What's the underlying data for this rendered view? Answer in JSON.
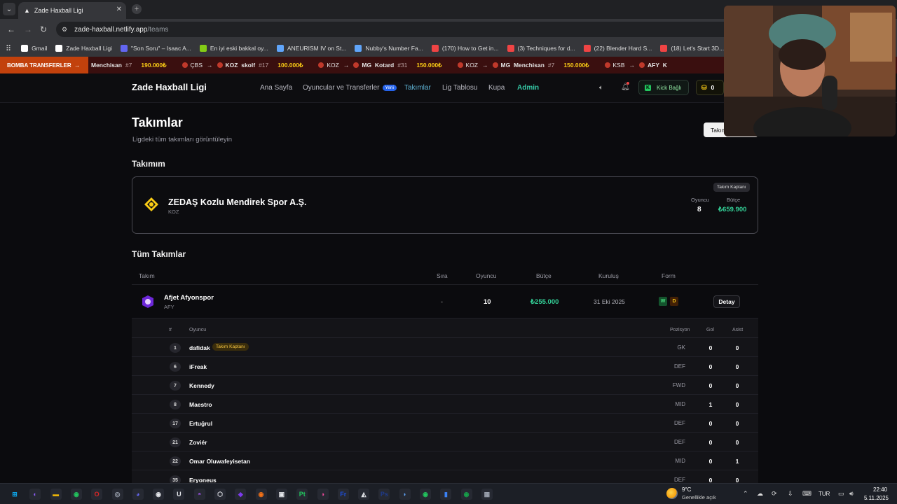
{
  "browser": {
    "tab_title": "Zade Haxball Ligi",
    "url_host": "zade-haxball.netlify.app",
    "url_path": "/teams",
    "bookmarks": [
      {
        "label": "Gmail",
        "color": "#ffffff"
      },
      {
        "label": "Zade Haxball Ligi",
        "color": "#ffffff"
      },
      {
        "label": "\"Son Soru\" – Isaac A...",
        "color": "#6366f1"
      },
      {
        "label": "En iyi eski bakkal oy...",
        "color": "#84cc16"
      },
      {
        "label": "ANEURISM IV on St...",
        "color": "#60a5fa"
      },
      {
        "label": "Nubby's Number Fa...",
        "color": "#60a5fa"
      },
      {
        "label": "(170) How to Get in...",
        "color": "#ef4444"
      },
      {
        "label": "(3) Techniques for d...",
        "color": "#ef4444"
      },
      {
        "label": "(22) Blender Hard S...",
        "color": "#ef4444"
      },
      {
        "label": "(18) Let's Start 3D...",
        "color": "#ef4444"
      },
      {
        "label": "(214) Av...",
        "color": "#ef4444"
      }
    ]
  },
  "ticker": {
    "label": "BOMBA TRANSFERLER",
    "items": [
      {
        "name": "Menchisan",
        "no": "#7",
        "price": "190.000₺",
        "from": "",
        "to": ""
      },
      {
        "from": "ÇBS",
        "to": "KOZ",
        "name": "skolf",
        "no": "#17",
        "price": "100.000₺"
      },
      {
        "from": "KOZ",
        "to": "MG",
        "name": "Kotard",
        "no": "#31",
        "price": "150.000₺"
      },
      {
        "from": "KOZ",
        "to": "MG",
        "name": "Menchisan",
        "no": "#7",
        "price": "150.000₺"
      },
      {
        "from": "KSB",
        "to": "AFY",
        "name": "K",
        "no": "",
        "price": ""
      }
    ]
  },
  "nav": {
    "brand": "Zade Haxball Ligi",
    "links": {
      "home": "Ana Sayfa",
      "players": "Oyuncular ve Transferler",
      "new_badge": "Yeni",
      "teams": "Takımlar",
      "table": "Lig Tablosu",
      "cup": "Kupa",
      "admin": "Admin"
    },
    "kick_label": "Kick Bağlı",
    "coins": "0"
  },
  "page": {
    "title": "Takımlar",
    "subtitle": "Ligdeki tüm takımları görüntüleyin",
    "create_button": "Takım K..."
  },
  "my_team": {
    "heading": "Takımım",
    "name": "ZEDAŞ Kozlu Mendirek Spor A.Ş.",
    "code": "KOZ",
    "captain_badge": "Takım Kaptanı",
    "players_label": "Oyuncu",
    "players": "8",
    "budget_label": "Bütçe",
    "budget": "₺659.900"
  },
  "all_teams": {
    "heading": "Tüm Takımlar",
    "columns": {
      "team": "Takım",
      "rank": "Sıra",
      "players": "Oyuncu",
      "budget": "Bütçe",
      "founded": "Kuruluş",
      "form": "Form"
    },
    "rows": [
      {
        "name": "Afjet Afyonspor",
        "code": "AFY",
        "rank": "-",
        "players": "10",
        "budget": "₺255.000",
        "founded": "31 Eki 2025",
        "form": [
          "W",
          "D"
        ],
        "detail_label": "Detay"
      }
    ]
  },
  "roster": {
    "columns": {
      "no": "#",
      "player": "Oyuncu",
      "position": "Pozisyon",
      "goals": "Gol",
      "assists": "Asist"
    },
    "captain_badge": "Takım Kaptanı",
    "players": [
      {
        "no": "1",
        "name": "dafidak",
        "captain": true,
        "pos": "GK",
        "goals": "0",
        "assists": "0"
      },
      {
        "no": "6",
        "name": "iFreak",
        "captain": false,
        "pos": "DEF",
        "goals": "0",
        "assists": "0"
      },
      {
        "no": "7",
        "name": "Kennedy",
        "captain": false,
        "pos": "FWD",
        "goals": "0",
        "assists": "0"
      },
      {
        "no": "8",
        "name": "Maestro",
        "captain": false,
        "pos": "MID",
        "goals": "1",
        "assists": "0"
      },
      {
        "no": "17",
        "name": "Ertuğrul",
        "captain": false,
        "pos": "DEF",
        "goals": "0",
        "assists": "0"
      },
      {
        "no": "21",
        "name": "Zoviér",
        "captain": false,
        "pos": "DEF",
        "goals": "0",
        "assists": "0"
      },
      {
        "no": "22",
        "name": "Omar Oluwafeyisetan",
        "captain": false,
        "pos": "MID",
        "goals": "0",
        "assists": "1"
      },
      {
        "no": "35",
        "name": "Eryoneus",
        "captain": false,
        "pos": "DEF",
        "goals": "0",
        "assists": "0"
      }
    ]
  },
  "taskbar": {
    "weather_temp": "9°C",
    "weather_desc": "Genellikle açık",
    "language": "TUR",
    "time": "22:40",
    "date": "5.11.2025",
    "apps": [
      "start-icon",
      "copilot-icon",
      "file-explorer-icon",
      "chrome-icon",
      "opera-icon",
      "github-desktop-icon",
      "discord-icon",
      "obs-icon",
      "unreal-icon",
      "github-icon",
      "unity-icon",
      "visual-studio-icon",
      "blender-icon",
      "roblox-icon",
      "pt-icon",
      "davinci-icon",
      "fresco-icon",
      "inkscape-icon",
      "photoshop-icon",
      "steam-icon",
      "spotify-icon",
      "notion-icon",
      "spotify-alt-icon",
      "calculator-icon"
    ]
  }
}
